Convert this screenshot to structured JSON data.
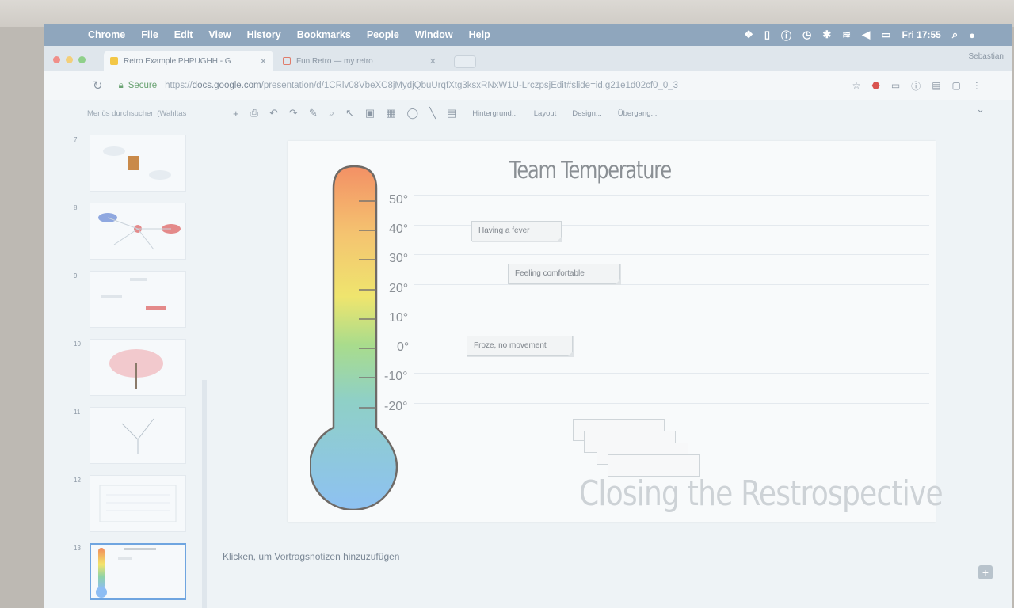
{
  "menubar": {
    "items": [
      "Chrome",
      "File",
      "Edit",
      "View",
      "History",
      "Bookmarks",
      "People",
      "Window",
      "Help"
    ],
    "clock": "Fri 17:55"
  },
  "tabs": [
    {
      "title": "Retro Example PHPUGHH - G"
    },
    {
      "title": "Fun Retro — my retro"
    }
  ],
  "profile": "Sebastian",
  "address": {
    "secure_label": "Secure",
    "url_scheme": "https://",
    "url_host": "docs.google.com",
    "url_path": "/presentation/d/1CRlv08VbeXC8jMydjQbuUrqfXtg3ksxRNxW1U-LrczpsjEdit#slide=id.g21e1d02cf0_0_3"
  },
  "toolbar": {
    "menu_search": "Menüs durchsuchen (Wahltas",
    "background": "Hintergrund...",
    "layout": "Layout",
    "design": "Design...",
    "transition": "Übergang..."
  },
  "filmstrip": {
    "numbers": [
      "7",
      "8",
      "9",
      "10",
      "11",
      "12",
      "13"
    ]
  },
  "slide": {
    "title": "Team Temperature",
    "scale": [
      "50°",
      "40°",
      "30°",
      "20°",
      "10°",
      "0°",
      "-10°",
      "-20°"
    ],
    "notes": [
      "Having a fever",
      "Feeling comfortable",
      "Froze, no movement"
    ],
    "footer": "Closing the Restrospective"
  },
  "speaker_notes_placeholder": "Klicken, um Vortragsnotizen hinzuzufügen"
}
